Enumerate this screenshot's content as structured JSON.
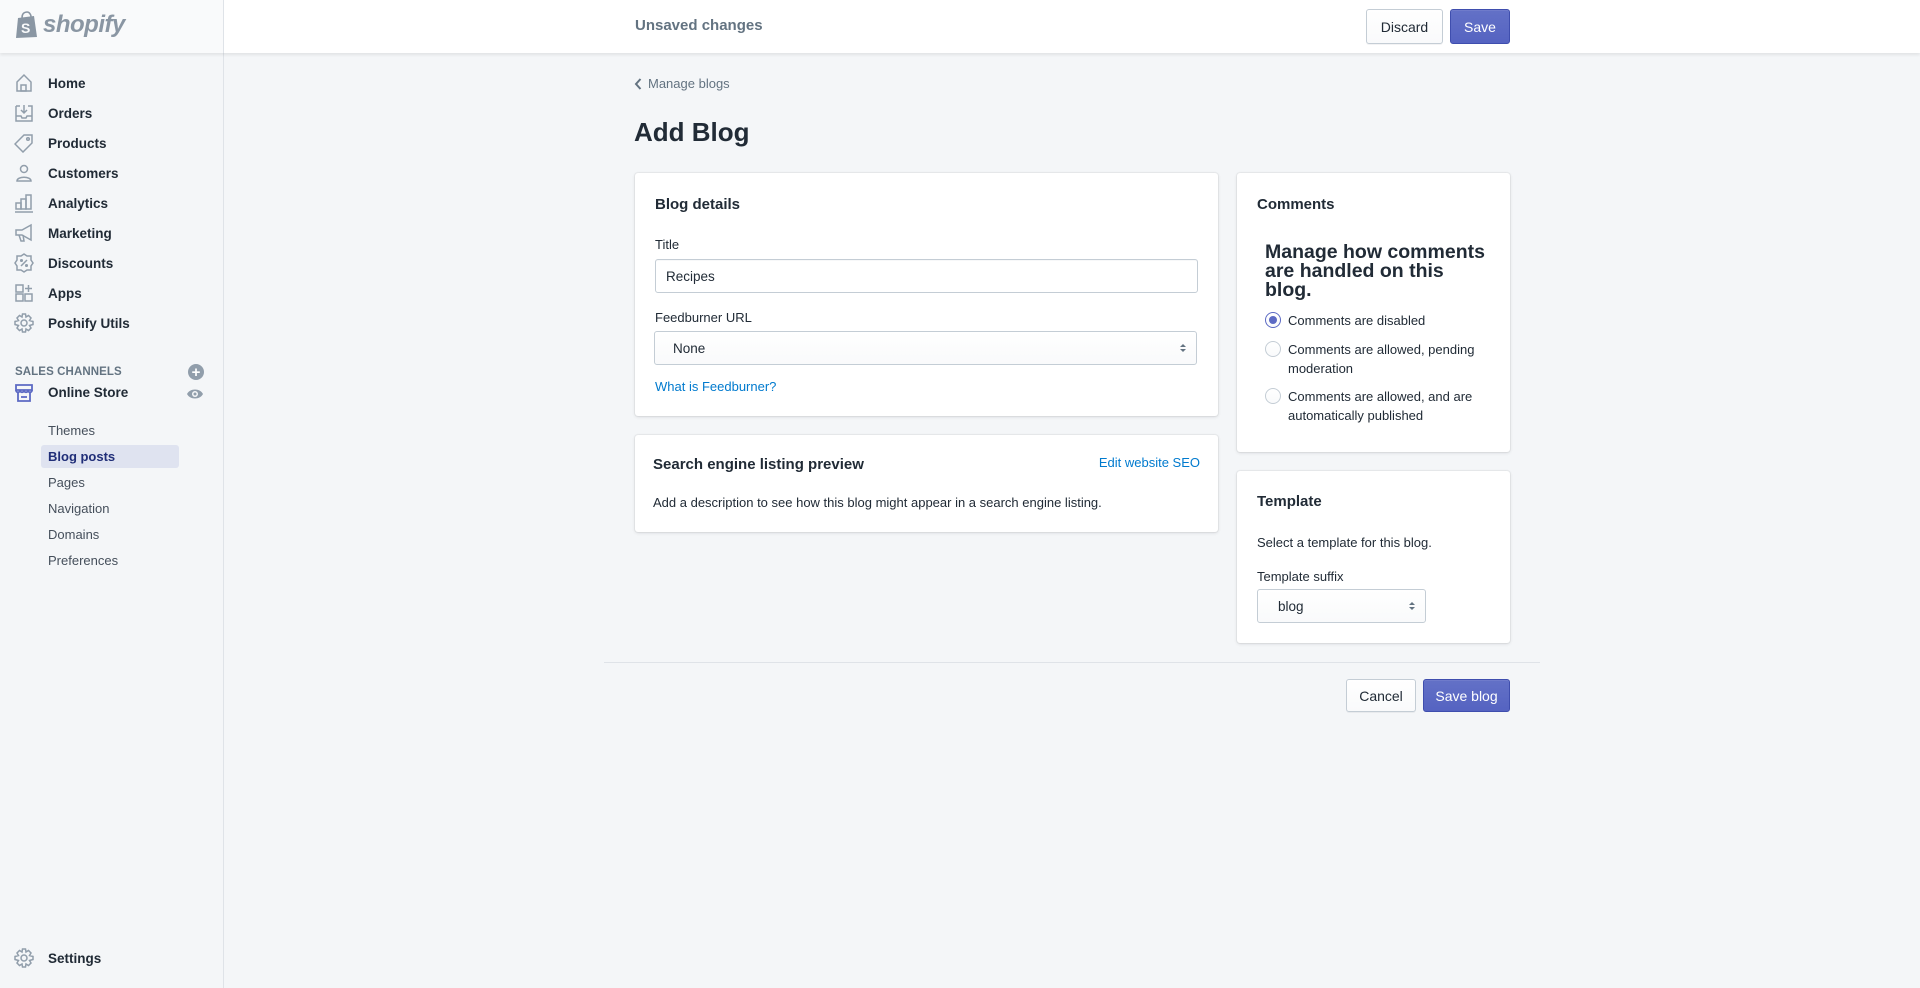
{
  "brand": {
    "name": "shopify"
  },
  "topbar": {
    "status": "Unsaved changes",
    "discard_label": "Discard",
    "save_label": "Save"
  },
  "sidebar": {
    "items": [
      {
        "label": "Home",
        "icon": "home-icon"
      },
      {
        "label": "Orders",
        "icon": "orders-icon"
      },
      {
        "label": "Products",
        "icon": "tag-icon"
      },
      {
        "label": "Customers",
        "icon": "person-icon"
      },
      {
        "label": "Analytics",
        "icon": "bar-chart-icon"
      },
      {
        "label": "Marketing",
        "icon": "megaphone-icon"
      },
      {
        "label": "Discounts",
        "icon": "discount-icon"
      },
      {
        "label": "Apps",
        "icon": "apps-icon"
      },
      {
        "label": "Poshify Utils",
        "icon": "gear-icon"
      }
    ],
    "sales_channels_title": "SALES CHANNELS",
    "online_store": {
      "label": "Online Store",
      "sub_items": [
        {
          "label": "Themes",
          "active": false
        },
        {
          "label": "Blog posts",
          "active": true
        },
        {
          "label": "Pages",
          "active": false
        },
        {
          "label": "Navigation",
          "active": false
        },
        {
          "label": "Domains",
          "active": false
        },
        {
          "label": "Preferences",
          "active": false
        }
      ]
    },
    "settings_label": "Settings"
  },
  "page": {
    "breadcrumb": "Manage blogs",
    "title": "Add Blog"
  },
  "blog_details": {
    "title": "Blog details",
    "title_label": "Title",
    "title_value": "Recipes",
    "feedburner_label": "Feedburner URL",
    "feedburner_value": "None",
    "feedburner_link": "What is Feedburner?"
  },
  "seo": {
    "title": "Search engine listing preview",
    "edit_link": "Edit website SEO",
    "description": "Add a description to see how this blog might appear in a search engine listing."
  },
  "comments": {
    "title": "Comments",
    "heading": "Manage how comments are handled on this blog.",
    "options": [
      {
        "label": "Comments are disabled",
        "checked": true
      },
      {
        "label": "Comments are allowed, pending moderation",
        "checked": false
      },
      {
        "label": "Comments are allowed, and are automatically published",
        "checked": false
      }
    ]
  },
  "template": {
    "title": "Template",
    "description": "Select a template for this blog.",
    "suffix_label": "Template suffix",
    "suffix_value": "blog"
  },
  "footer": {
    "cancel_label": "Cancel",
    "save_label": "Save blog"
  },
  "colors": {
    "primary": "#5c6ac4",
    "link": "#007ace",
    "active_nav_bg": "#dfe3f0",
    "active_nav_text": "#202e78"
  }
}
